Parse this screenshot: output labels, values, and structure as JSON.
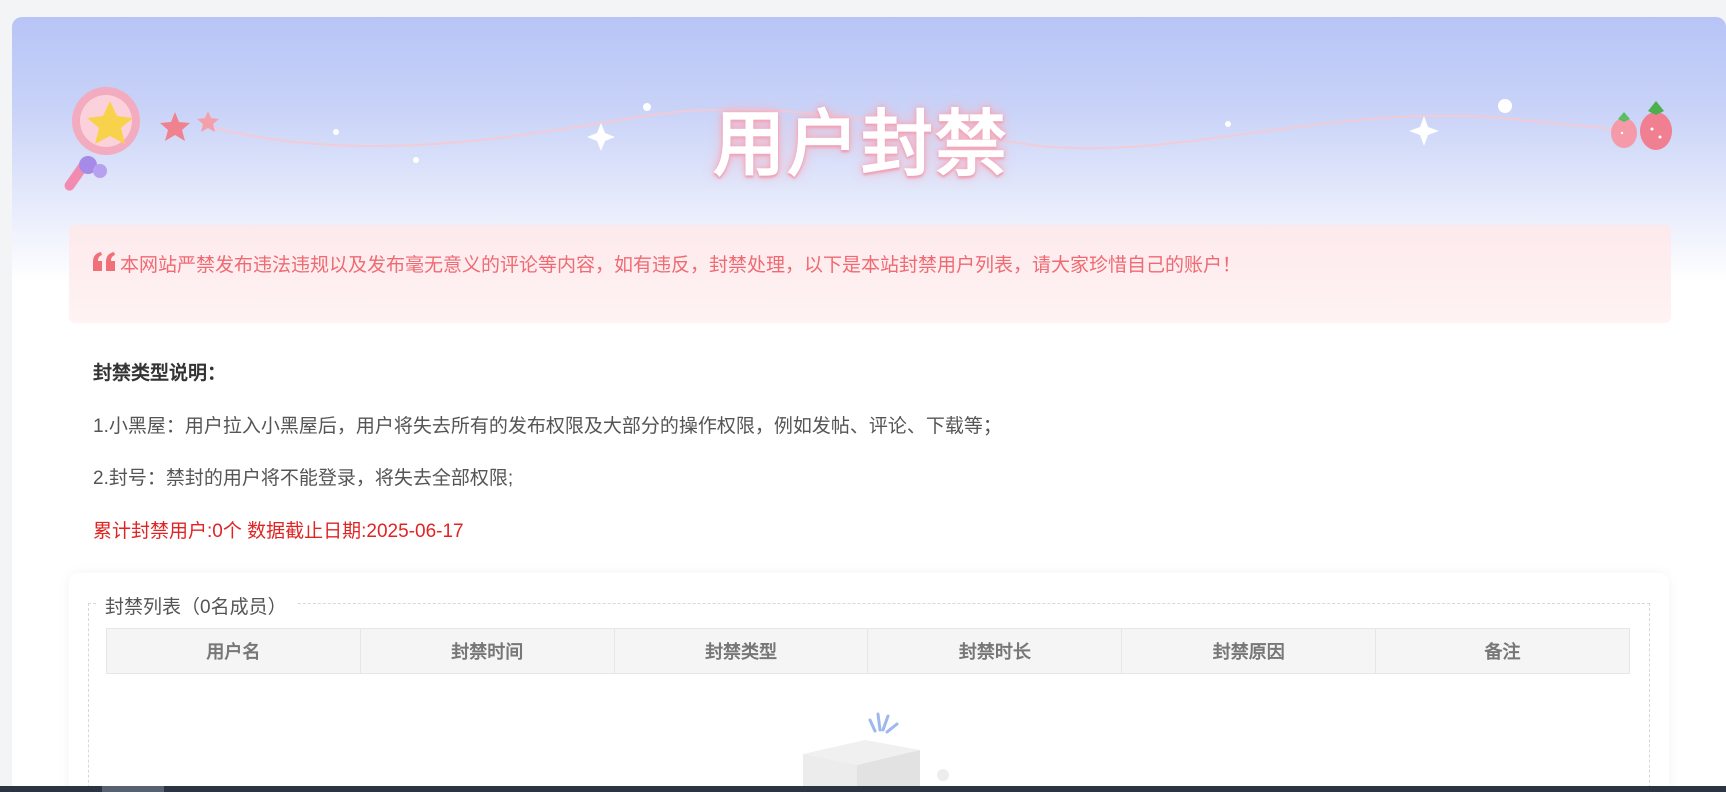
{
  "page": {
    "title": "用户封禁"
  },
  "notice": {
    "icon": "quote-icon",
    "text": "本网站严禁发布违法违规以及发布毫无意义的评论等内容，如有违反，封禁处理，以下是本站封禁用户列表，请大家珍惜自己的账户！",
    "color": "#ef6a72"
  },
  "description": {
    "heading": "封禁类型说明：",
    "item1": "1.小黑屋：用户拉入小黑屋后，用户将失去所有的发布权限及大部分的操作权限，例如发帖、评论、下载等；",
    "item2": "2.封号：禁封的用户将不能登录，将失去全部权限;",
    "stats": "累计封禁用户:0个 数据截止日期:2025-06-17",
    "stats_color": "#e02424"
  },
  "ban_list": {
    "legend": "封禁列表（0名成员）",
    "columns": [
      "用户名",
      "封禁时间",
      "封禁类型",
      "封禁时长",
      "封禁原因",
      "备注"
    ]
  },
  "colors": {
    "banner_top": "#b7c4f6",
    "title_glow": "#f4a3b6"
  }
}
